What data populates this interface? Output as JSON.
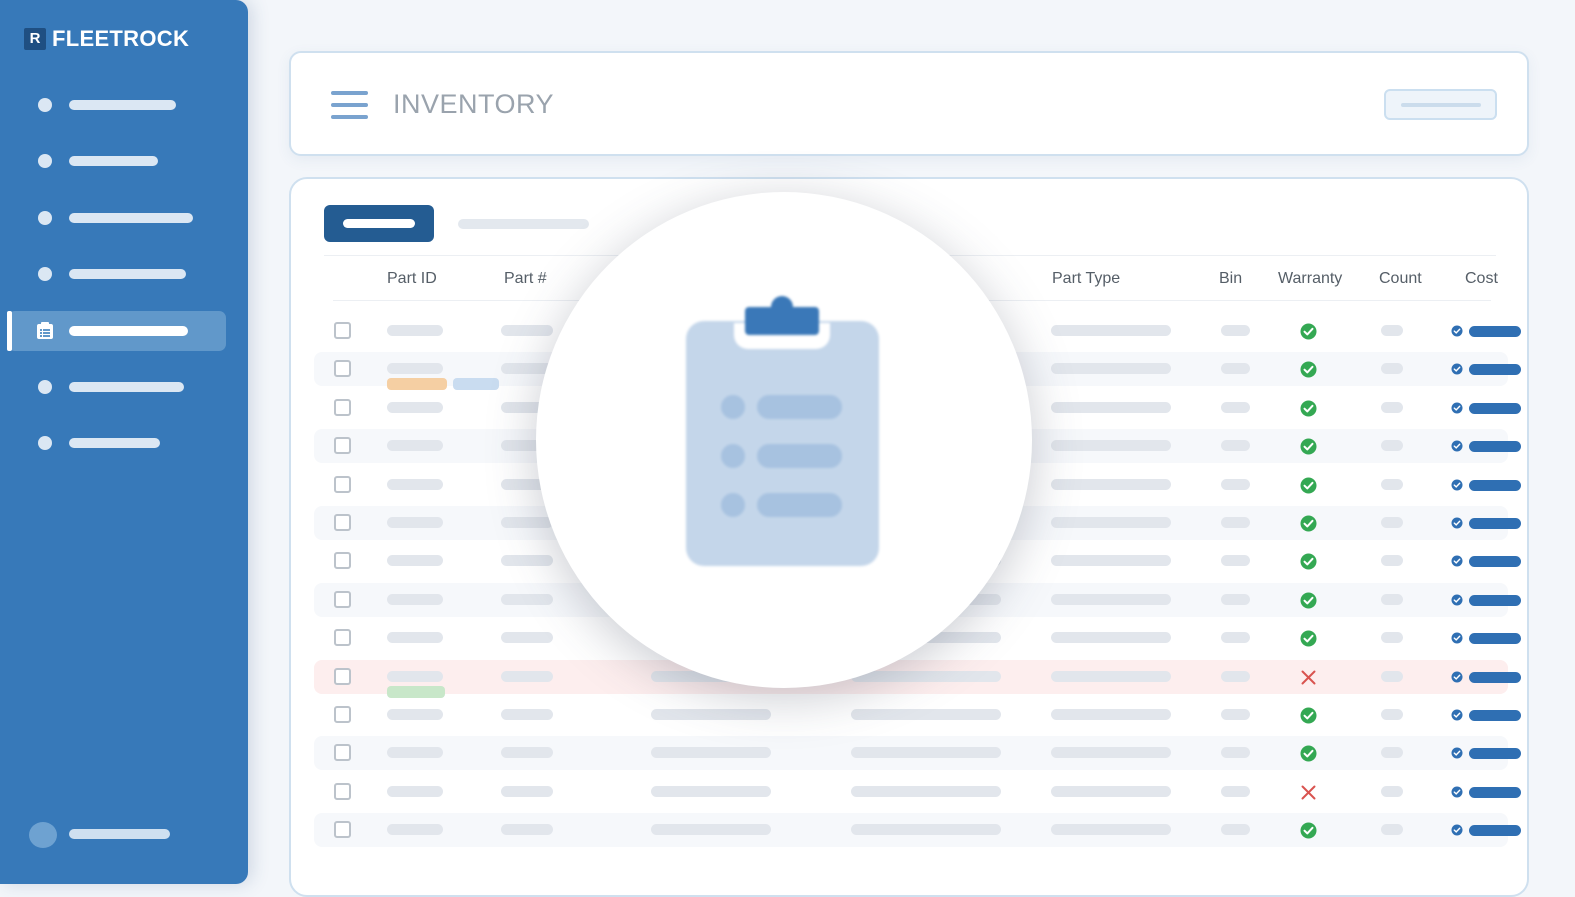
{
  "brand": {
    "logo_glyph": "R",
    "name": "FLEETROCK"
  },
  "sidebar": {
    "active_index": 4,
    "items": [
      {
        "icon": "dot-icon"
      },
      {
        "icon": "dot-icon"
      },
      {
        "icon": "dot-icon"
      },
      {
        "icon": "dot-icon"
      },
      {
        "icon": "clipboard-list-icon",
        "active": true
      },
      {
        "icon": "dot-icon"
      },
      {
        "icon": "dot-icon"
      }
    ],
    "footer": {
      "avatar": "avatar"
    }
  },
  "header": {
    "title": "INVENTORY",
    "menu_icon": "hamburger-icon"
  },
  "table": {
    "columns": [
      "Part ID",
      "Part #",
      "Part Type",
      "Bin",
      "Warranty",
      "Count",
      "Cost"
    ],
    "warranty_status": [
      "ok",
      "ok",
      "ok",
      "ok",
      "ok",
      "ok",
      "ok",
      "ok",
      "ok",
      "fail",
      "ok",
      "ok",
      "fail",
      "ok"
    ],
    "flagged_row": 10
  },
  "spotlight": {
    "icon": "clipboard-list-icon"
  },
  "colors": {
    "sidebar": "#3779b9",
    "accent": "#245c92",
    "cost_bar": "#2f6fb3",
    "ok_green": "#34a853",
    "fail_red": "#d9534f",
    "alert_row": "#fdeeee",
    "tag_orange": "#f5cfa3",
    "tag_blue": "#c9dcf0",
    "tag_green": "#c8e7c9"
  }
}
